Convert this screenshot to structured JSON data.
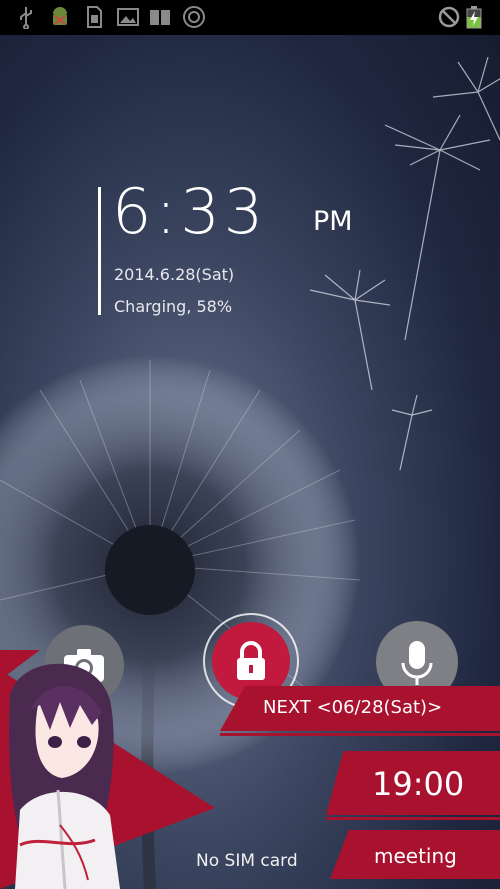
{
  "status_bar": {
    "left_icons": [
      "usb-icon",
      "android-debug-icon",
      "sd-card-icon",
      "image-icon",
      "book-icon",
      "camera-shutter-icon"
    ],
    "right_icons": [
      "no-sim-icon",
      "battery-charging-icon"
    ]
  },
  "lockscreen": {
    "time": "6:33",
    "ampm": "PM",
    "date": "2014.6.28(Sat)",
    "charging": "Charging, 58%",
    "sim_status": "No SIM card"
  },
  "shortcuts": {
    "left": "camera-icon",
    "center": "lock-icon",
    "right": "microphone-icon"
  },
  "schedule": {
    "next_label": "NEXT <06/28(Sat)>",
    "time": "19:00",
    "event": "meeting"
  },
  "colors": {
    "accent_red": "#a8122e",
    "lock_red": "#c11a3e",
    "status_bar": "#000000"
  }
}
